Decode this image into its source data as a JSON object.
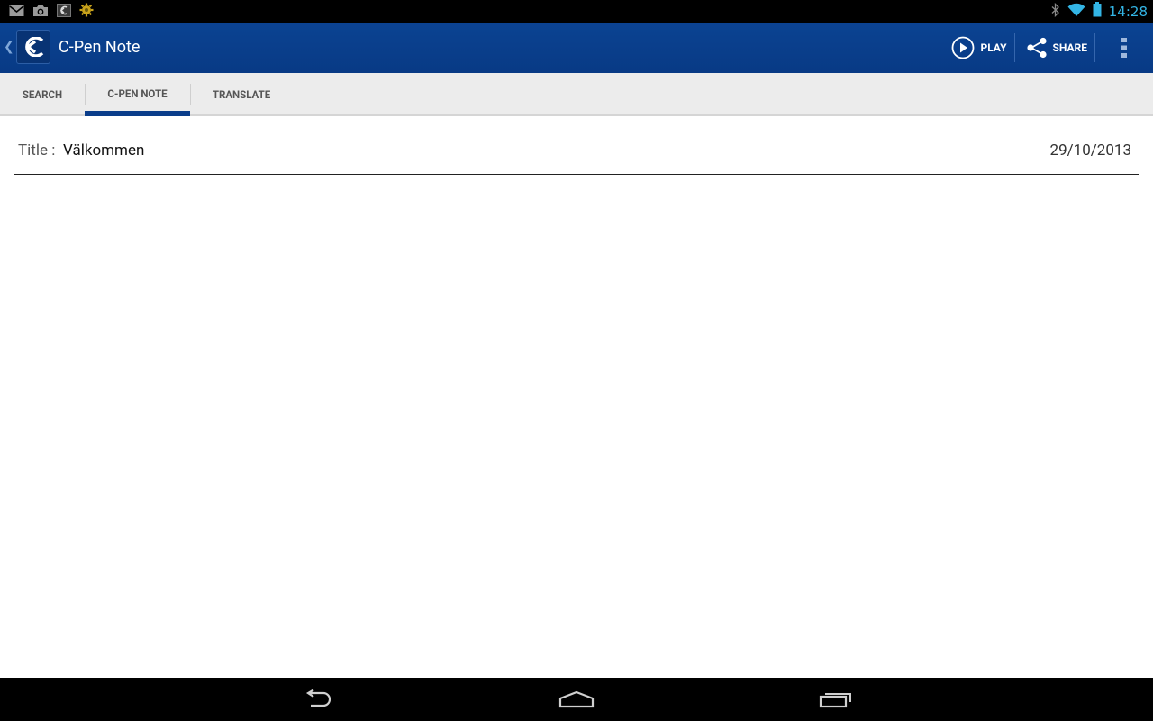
{
  "status_bar": {
    "time": "14:28",
    "left_icons": [
      "gmail-icon",
      "camera-icon",
      "c-pen-icon",
      "settings-app-icon"
    ],
    "right_icons": [
      "bluetooth-icon",
      "wifi-icon",
      "battery-icon"
    ],
    "accent_color": "#33b5e5"
  },
  "action_bar": {
    "title": "C-Pen Note",
    "background_color": "#0a3d8a",
    "play_label": "PLAY",
    "share_label": "SHARE"
  },
  "tabs": [
    {
      "label": "SEARCH",
      "active": false
    },
    {
      "label": "C-PEN NOTE",
      "active": true
    },
    {
      "label": "TRANSLATE",
      "active": false
    }
  ],
  "note": {
    "title_label": "Title :",
    "title_value": "Välkommen",
    "date": "29/10/2013",
    "body": ""
  },
  "nav_bar": {
    "buttons": [
      "back-icon",
      "home-icon",
      "recent-apps-icon"
    ]
  }
}
